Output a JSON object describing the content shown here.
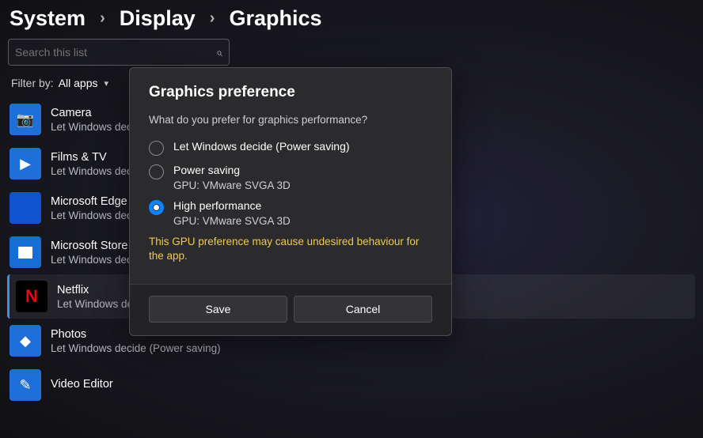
{
  "breadcrumb": {
    "a": "System",
    "b": "Display",
    "c": "Graphics"
  },
  "search": {
    "placeholder": "Search this list"
  },
  "filter": {
    "label": "Filter by:",
    "value": "All apps"
  },
  "apps": [
    {
      "name": "Camera",
      "sub": "Let Windows dec",
      "icon": "camera"
    },
    {
      "name": "Films & TV",
      "sub": "Let Windows dec",
      "icon": "films"
    },
    {
      "name": "Microsoft Edge",
      "sub": "Let Windows dec",
      "icon": "edge"
    },
    {
      "name": "Microsoft Store",
      "sub": "Let Windows dec",
      "icon": "store"
    },
    {
      "name": "Netflix",
      "sub": "Let Windows dec",
      "icon": "netflix",
      "selected": true
    },
    {
      "name": "Photos",
      "sub": "Let Windows decide (Power saving)",
      "icon": "photos"
    },
    {
      "name": "Video Editor",
      "sub": "",
      "icon": "video"
    }
  ],
  "dialog": {
    "title": "Graphics preference",
    "question": "What do you prefer for graphics performance?",
    "options": [
      {
        "label": "Let Windows decide (Power saving)",
        "sub": "",
        "checked": false
      },
      {
        "label": "Power saving",
        "sub": "GPU: VMware SVGA 3D",
        "checked": false
      },
      {
        "label": "High performance",
        "sub": "GPU: VMware SVGA 3D",
        "checked": true
      }
    ],
    "warning": "This GPU preference may cause undesired behaviour for the app.",
    "save": "Save",
    "cancel": "Cancel"
  }
}
